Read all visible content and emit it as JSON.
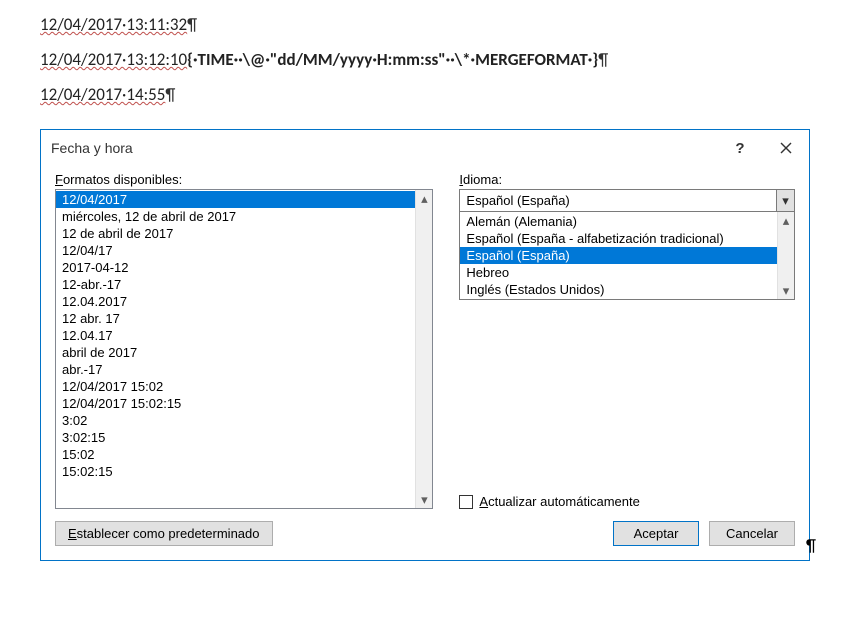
{
  "doc": {
    "line1_a": "12/04/2017·13:11:32",
    "line2_a": "12/04/2017·13:12:10",
    "line2_field": "{·TIME··\\@·\"dd/MM/yyyy·H:mm:ss\"··\\*·MERGEFORMAT·}",
    "line3_a": "12/04/2017·14:55",
    "pilcrow": "¶"
  },
  "dialog": {
    "title": "Fecha y hora",
    "help": "?",
    "formats_label_pre": "F",
    "formats_label_rest": "ormatos disponibles:",
    "idioma_label_pre": "I",
    "idioma_label_rest": "dioma:",
    "formats": [
      "12/04/2017",
      "miércoles, 12 de abril de 2017",
      "12 de abril de 2017",
      "12/04/17",
      "2017-04-12",
      "12-abr.-17",
      "12.04.2017",
      "12 abr. 17",
      "12.04.17",
      "abril de 2017",
      "abr.-17",
      "12/04/2017 15:02",
      "12/04/2017 15:02:15",
      "3:02",
      "3:02:15",
      "15:02",
      "15:02:15"
    ],
    "formats_selected_index": 0,
    "language_selected": "Español (España)",
    "languages": [
      "Alemán (Alemania)",
      "Español (España - alfabetización tradicional)",
      "Español (España)",
      "Hebreo",
      "Inglés (Estados Unidos)"
    ],
    "languages_selected_index": 2,
    "auto_update_pre": "A",
    "auto_update_rest": "ctualizar automáticamente",
    "default_btn_pre": "E",
    "default_btn_rest": "stablecer como predeterminado",
    "ok": "Aceptar",
    "cancel": "Cancelar"
  }
}
